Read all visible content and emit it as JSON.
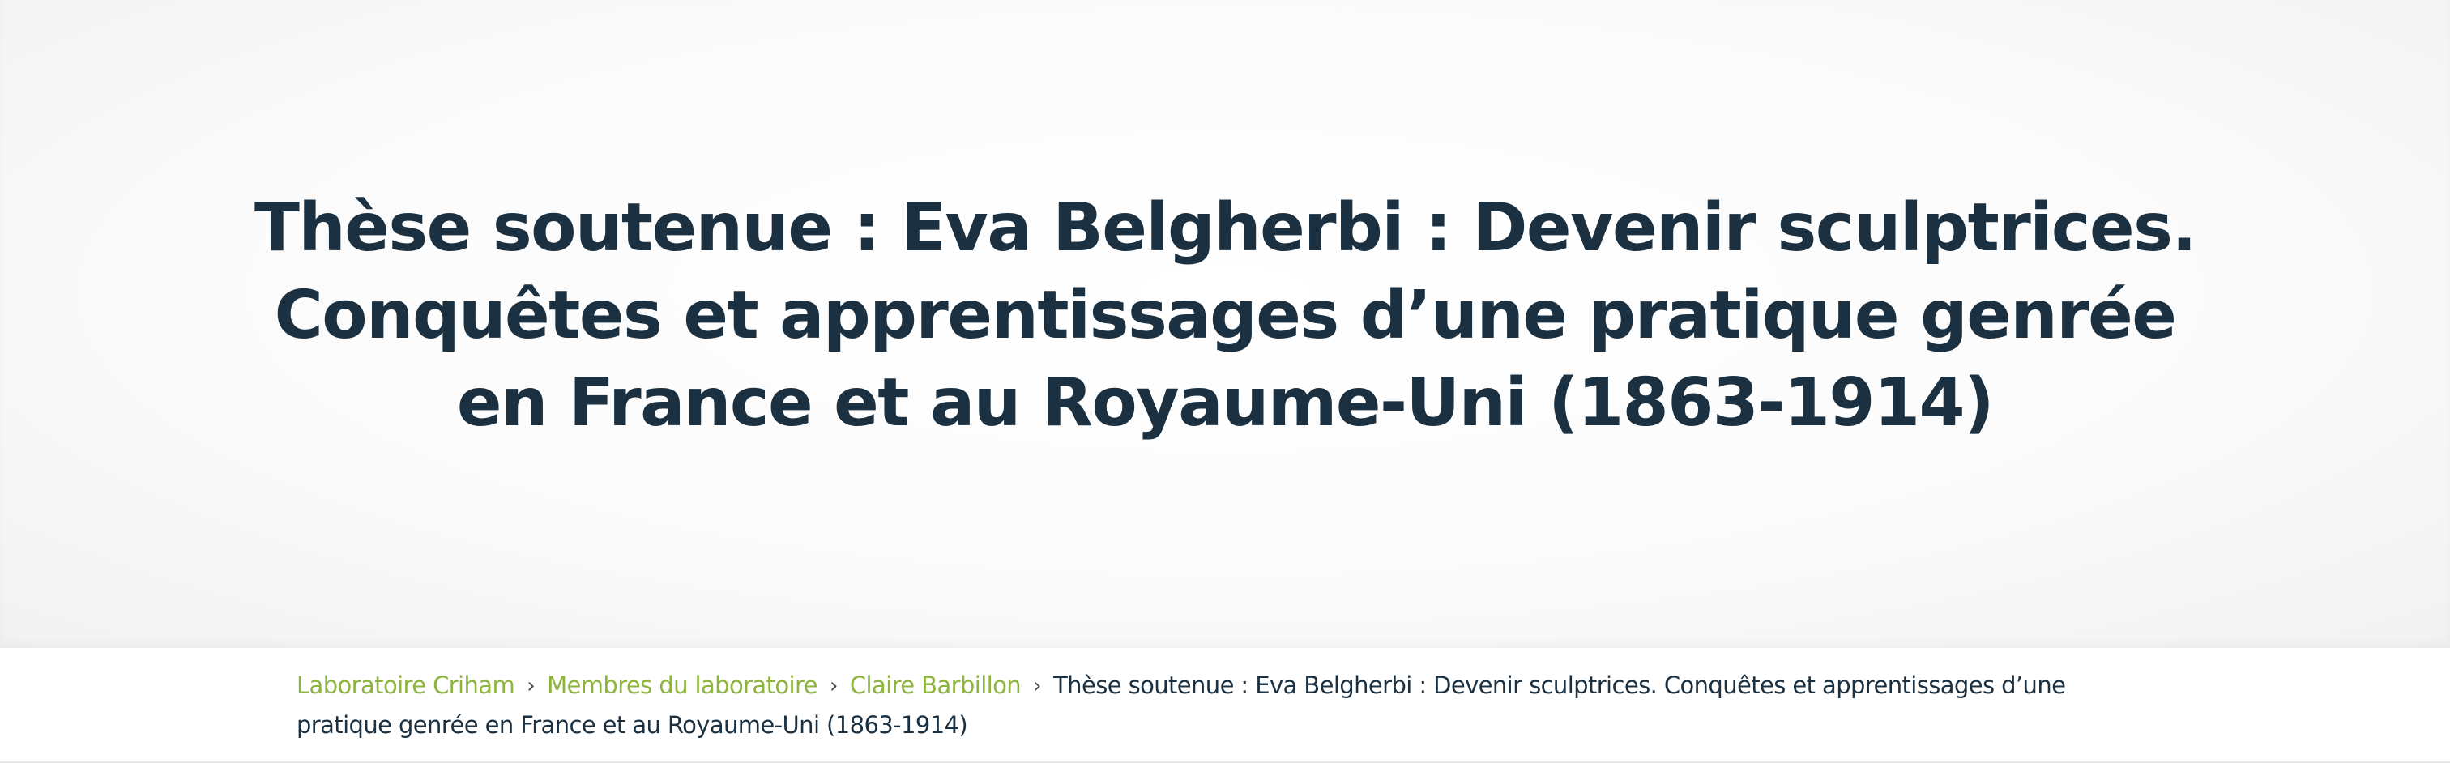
{
  "hero": {
    "title": "Thèse soutenue : Eva Belgherbi : Devenir sculptrices. Conquêtes et apprentissages d’une pratique genrée en France et au Royaume-Uni (1863-1914)"
  },
  "breadcrumb": {
    "items": [
      {
        "label": "Laboratoire Criham"
      },
      {
        "label": "Membres du laboratoire"
      },
      {
        "label": "Claire Barbillon"
      }
    ],
    "current": "Thèse soutenue : Eva Belgherbi : Devenir sculptrices. Conquêtes et apprentissages d’une pratique genrée en France et au Royaume-Uni (1863-1914)",
    "separator": "›"
  },
  "colors": {
    "title": "#1b3142",
    "link": "#8db43c",
    "hero_background": "#f7f7f7"
  }
}
